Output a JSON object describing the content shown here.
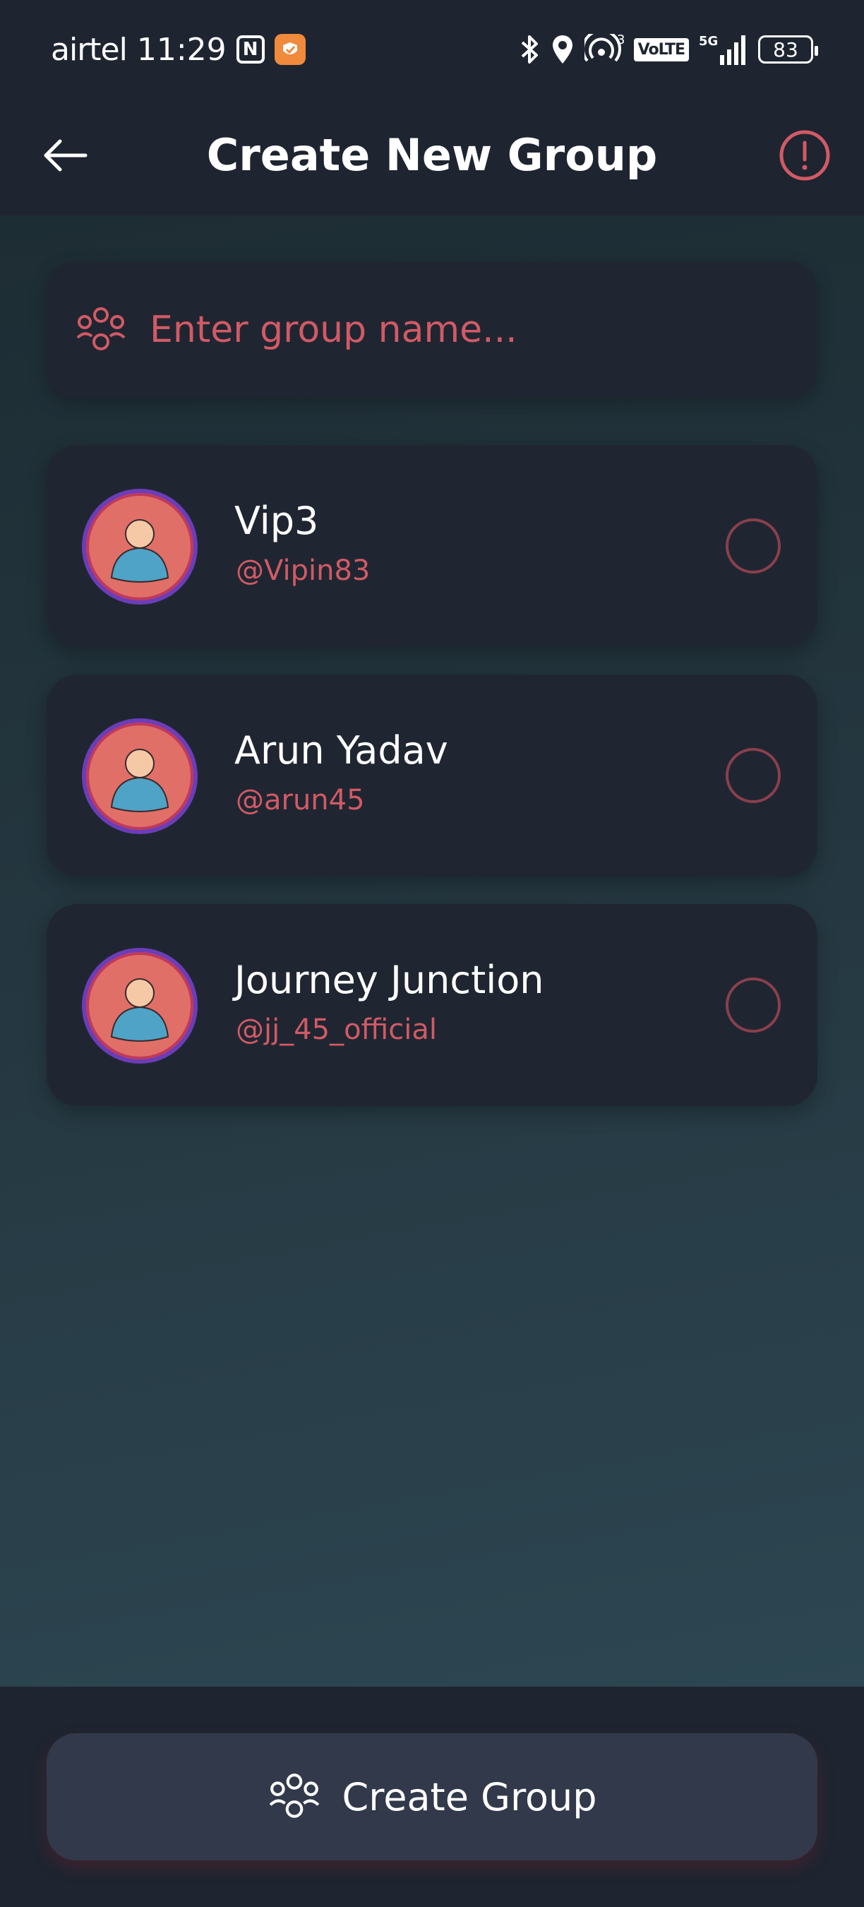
{
  "status_bar": {
    "carrier": "airtel",
    "time": "11:29",
    "network": "5G",
    "signal_sup": "3",
    "volte": "VoLTE",
    "battery": "83"
  },
  "header": {
    "title": "Create New Group"
  },
  "group_input": {
    "placeholder": "Enter group name...",
    "value": ""
  },
  "contacts": [
    {
      "name": "Vip3",
      "handle": "@Vipin83",
      "selected": false
    },
    {
      "name": "Arun Yadav",
      "handle": "@arun45",
      "selected": false
    },
    {
      "name": "Journey Junction",
      "handle": "@jj_45_official",
      "selected": false
    }
  ],
  "footer": {
    "create_label": "Create Group"
  },
  "colors": {
    "accent": "#d15a66",
    "card": "#1f2631",
    "header": "#1e2530",
    "button": "#31394a"
  },
  "icons": {
    "back": "arrow-left-icon",
    "info": "alert-circle-icon",
    "group": "group-icon"
  }
}
